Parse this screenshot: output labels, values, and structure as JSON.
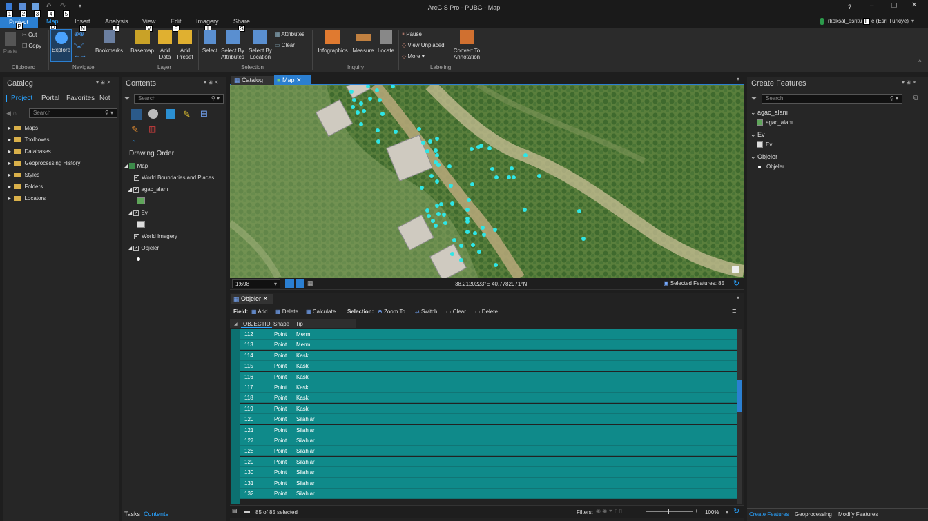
{
  "window": {
    "title": "ArcGIS Pro - PUBG - Map",
    "user": "rkoksal_esritu",
    "user_org": "e (Esri Türkiye)",
    "help": "?"
  },
  "qat_keytips": [
    "1",
    "2",
    "3",
    "4",
    "5"
  ],
  "ribbon_tabs": [
    {
      "label": "Project",
      "keytip": "P"
    },
    {
      "label": "Map",
      "keytip": "M"
    },
    {
      "label": "Insert",
      "keytip": "N"
    },
    {
      "label": "Analysis",
      "keytip": "A"
    },
    {
      "label": "View",
      "keytip": "V"
    },
    {
      "label": "Edit",
      "keytip": "E"
    },
    {
      "label": "Imagery",
      "keytip": "I"
    },
    {
      "label": "Share",
      "keytip": "S"
    }
  ],
  "ribbon": {
    "clipboard": {
      "paste": "Paste",
      "cut": "Cut",
      "copy": "Copy",
      "label": "Clipboard"
    },
    "navigate": {
      "explore": "Explore",
      "bookmarks": "Bookmarks",
      "label": "Navigate"
    },
    "layer": {
      "basemap": "Basemap",
      "add_data": "Add",
      "add_data2": "Data",
      "add_preset": "Add",
      "add_preset2": "Preset",
      "label": "Layer"
    },
    "selection": {
      "select": "Select",
      "by_attr": "Select By",
      "by_attr2": "Attributes",
      "by_loc": "Select By",
      "by_loc2": "Location",
      "attributes": "Attributes",
      "clear": "Clear",
      "label": "Selection"
    },
    "inquiry": {
      "infographics": "Infographics",
      "measure": "Measure",
      "locate": "Locate",
      "label": "Inquiry"
    },
    "labeling": {
      "pause": "Pause",
      "view_unplaced": "View Unplaced",
      "more": "More",
      "convert": "Convert To",
      "convert2": "Annotation",
      "label": "Labeling"
    }
  },
  "catalog": {
    "title": "Catalog",
    "tabs": [
      "Project",
      "Portal",
      "Favorites",
      "Not"
    ],
    "search_placeholder": "Search",
    "items": [
      "Maps",
      "Toolboxes",
      "Databases",
      "Geoprocessing History",
      "Styles",
      "Folders",
      "Locators"
    ]
  },
  "contents": {
    "title": "Contents",
    "search_placeholder": "Search",
    "drawing_order": "Drawing Order",
    "map": "Map",
    "layers": [
      "World Boundaries and Places",
      "agac_alanı",
      "Ev",
      "World Imagery",
      "Objeler"
    ],
    "bottom_tabs": [
      "Tasks",
      "Contents"
    ]
  },
  "view_tabs": [
    "Catalog",
    "Map"
  ],
  "map": {
    "scale": "1:698",
    "coords": "38.2120223°E 40.7782971°N",
    "selected": "Selected Features: 85"
  },
  "table": {
    "tab": "Objeler",
    "field_label": "Field:",
    "add": "Add",
    "delete": "Delete",
    "calculate": "Calculate",
    "selection_label": "Selection:",
    "zoom_to": "Zoom To",
    "switch": "Switch",
    "clear": "Clear",
    "delete2": "Delete",
    "columns": [
      "OBJECTID",
      "Shape",
      "Tip"
    ],
    "rows": [
      [
        "112",
        "Point",
        "Mermi"
      ],
      [
        "113",
        "Point",
        "Mermi"
      ],
      [
        "114",
        "Point",
        "Kask"
      ],
      [
        "115",
        "Point",
        "Kask"
      ],
      [
        "116",
        "Point",
        "Kask"
      ],
      [
        "117",
        "Point",
        "Kask"
      ],
      [
        "118",
        "Point",
        "Kask"
      ],
      [
        "119",
        "Point",
        "Kask"
      ],
      [
        "120",
        "Point",
        "Silahlar"
      ],
      [
        "121",
        "Point",
        "Silahlar"
      ],
      [
        "127",
        "Point",
        "Silahlar"
      ],
      [
        "128",
        "Point",
        "Silahlar"
      ],
      [
        "129",
        "Point",
        "Silahlar"
      ],
      [
        "130",
        "Point",
        "Silahlar"
      ],
      [
        "131",
        "Point",
        "Silahlar"
      ],
      [
        "132",
        "Point",
        "Silahlar"
      ]
    ],
    "status": "85 of 85 selected",
    "filters": "Filters:",
    "zoom": "100%"
  },
  "create_features": {
    "title": "Create Features",
    "search_placeholder": "Search",
    "groups": [
      {
        "name": "agac_alanı",
        "item": "agac_alanı"
      },
      {
        "name": "Ev",
        "item": "Ev"
      },
      {
        "name": "Objeler",
        "item": "Objeler"
      }
    ],
    "bottom_tabs": [
      "Create Features",
      "Geoprocessing",
      "Modify Features"
    ]
  },
  "colors": {
    "accent": "#29a3ff",
    "selection": "#0f8a8a",
    "points": "#2fe6e6"
  }
}
